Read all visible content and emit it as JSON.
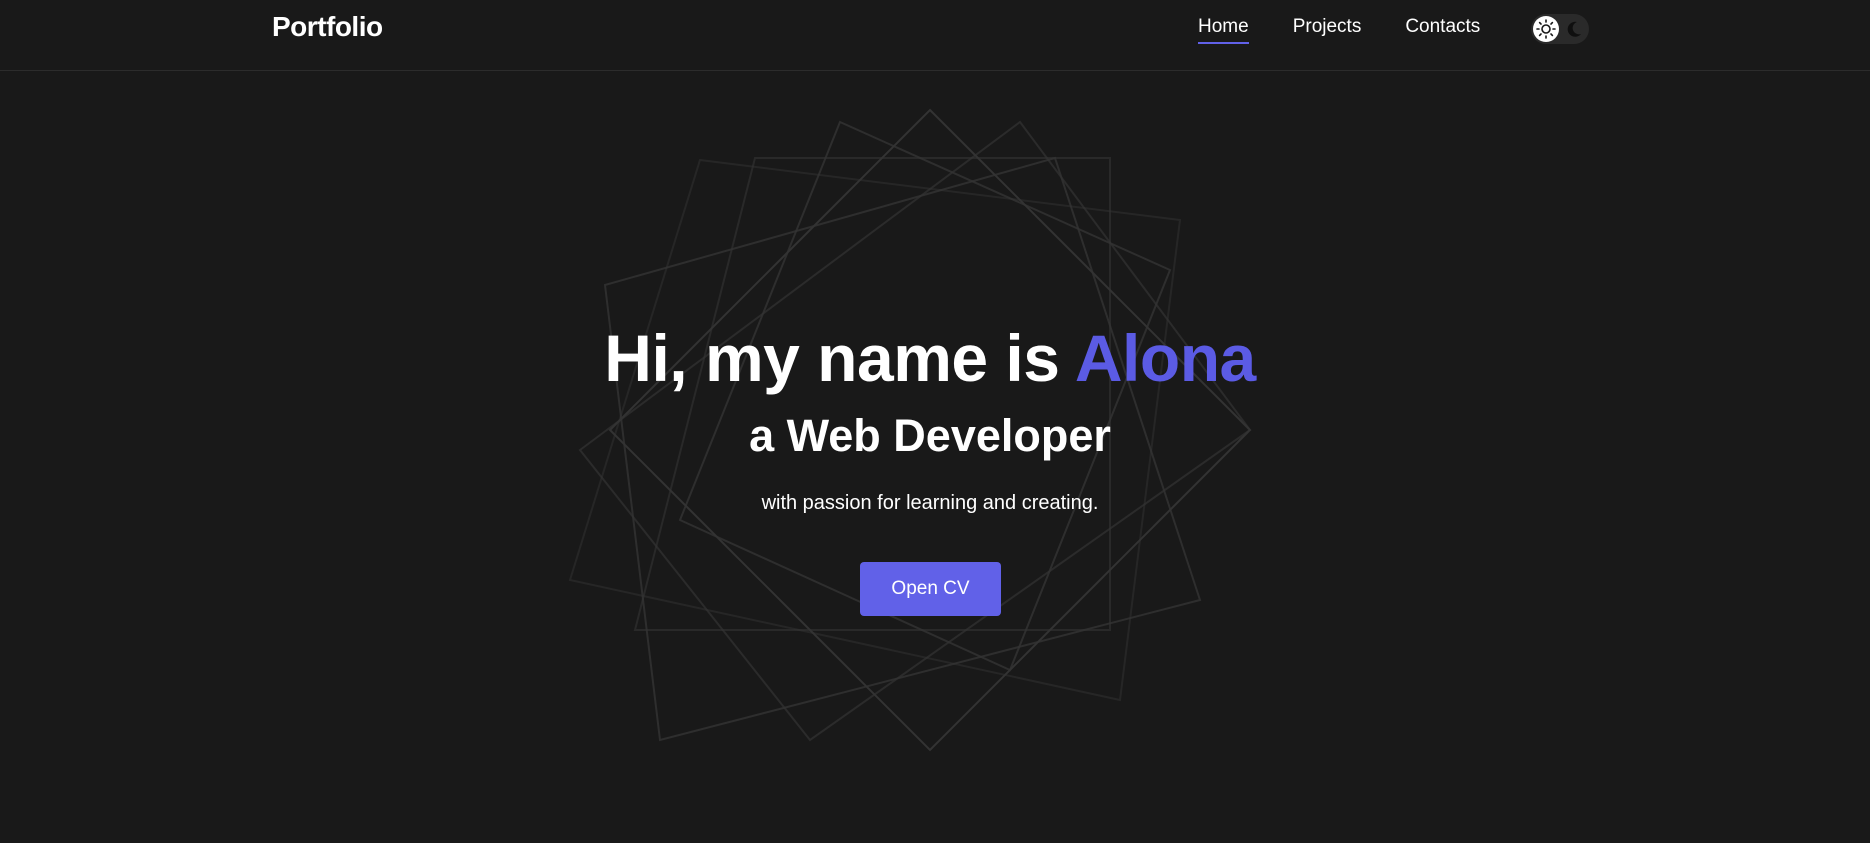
{
  "header": {
    "logo": "Portfolio",
    "nav": [
      {
        "label": "Home",
        "active": true
      },
      {
        "label": "Projects",
        "active": false
      },
      {
        "label": "Contacts",
        "active": false
      }
    ],
    "theme_toggle": {
      "light_icon": "sun-icon",
      "dark_icon": "moon-icon",
      "selected": "light"
    }
  },
  "hero": {
    "title_prefix": "Hi, my name is",
    "name": "Alona",
    "subtitle": "a Web Developer",
    "tagline": "with passion for learning and creating.",
    "cv_button": "Open CV"
  },
  "colors": {
    "background": "#191919",
    "accent": "#5b5be4",
    "button": "#6161e8",
    "text": "#ffffff"
  }
}
